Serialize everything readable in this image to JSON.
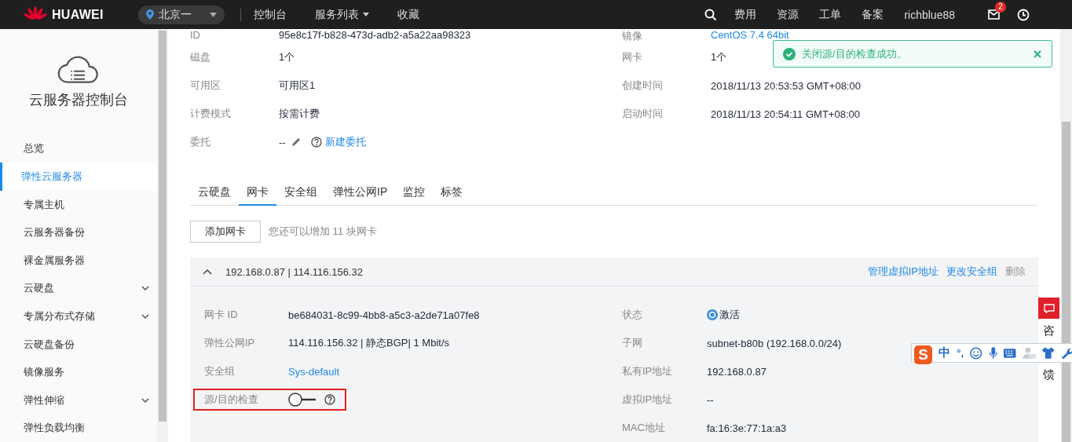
{
  "topbar": {
    "brand": "HUAWEI",
    "region": "北京一",
    "nav": [
      {
        "label": "控制台",
        "kind": "link"
      },
      {
        "label": "服务列表",
        "kind": "menu"
      },
      {
        "label": "收藏",
        "kind": "link"
      }
    ],
    "right_links": [
      "费用",
      "资源",
      "工单",
      "备案"
    ],
    "user": "richblue88",
    "mail_badge": "2"
  },
  "sidebar": {
    "title": "云服务器控制台",
    "items": [
      {
        "label": "总览",
        "kind": "link",
        "selected": false
      },
      {
        "label": "弹性云服务器",
        "kind": "link",
        "selected": true
      },
      {
        "label": "专属主机",
        "kind": "link",
        "selected": false
      },
      {
        "label": "云服务器备份",
        "kind": "link",
        "selected": false
      },
      {
        "label": "裸金属服务器",
        "kind": "link",
        "selected": false
      },
      {
        "label": "云硬盘",
        "kind": "group",
        "selected": false
      },
      {
        "label": "专属分布式存储",
        "kind": "group",
        "selected": false
      },
      {
        "label": "云硬盘备份",
        "kind": "link",
        "selected": false
      },
      {
        "label": "镜像服务",
        "kind": "link",
        "selected": false
      },
      {
        "label": "弹性伸缩",
        "kind": "group",
        "selected": false
      },
      {
        "label": "弹性负载均衡",
        "kind": "link",
        "selected": false
      }
    ]
  },
  "info": {
    "left": [
      {
        "label": "ID",
        "value": "95e8c17f-b828-473d-adb2-a5a22aa98323",
        "kind": "text"
      },
      {
        "label": "磁盘",
        "value": "1个",
        "kind": "text"
      },
      {
        "label": "可用区",
        "value": "可用区1",
        "kind": "text"
      },
      {
        "label": "计费模式",
        "value": "按需计费",
        "kind": "text"
      },
      {
        "label": "委托",
        "value": "--",
        "kind": "agency",
        "link": "新建委托"
      }
    ],
    "right": [
      {
        "label": "镜像",
        "value": "CentOS 7.4 64bit",
        "kind": "link"
      },
      {
        "label": "网卡",
        "value": "1个",
        "kind": "text"
      },
      {
        "label": "创建时间",
        "value": "2018/11/13 20:53:53 GMT+08:00",
        "kind": "text"
      },
      {
        "label": "启动时间",
        "value": "2018/11/13 20:54:11 GMT+08:00",
        "kind": "text"
      }
    ]
  },
  "tabs": [
    {
      "label": "云硬盘",
      "selected": false
    },
    {
      "label": "网卡",
      "selected": true
    },
    {
      "label": "安全组",
      "selected": false
    },
    {
      "label": "弹性公网IP",
      "selected": false
    },
    {
      "label": "监控",
      "selected": false
    },
    {
      "label": "标签",
      "selected": false
    }
  ],
  "add_button": "添加网卡",
  "add_hint": "您还可以增加 11 块网卡",
  "nic": {
    "title": "192.168.0.87 | 114.116.156.32",
    "expanded": true,
    "actions": [
      {
        "label": "管理虚拟IP地址",
        "disabled": false
      },
      {
        "label": "更改安全组",
        "disabled": false
      },
      {
        "label": "删除",
        "disabled": true
      }
    ],
    "left": [
      {
        "label": "网卡 ID",
        "value": "be684031-8c99-4bb8-a5c3-a2de71a07fe8",
        "kind": "text",
        "highlighted": false
      },
      {
        "label": "弹性公网IP",
        "value": "114.116.156.32 | 静态BGP| 1 Mbit/s",
        "kind": "text",
        "highlighted": false
      },
      {
        "label": "安全组",
        "value": "Sys-default",
        "kind": "link",
        "highlighted": false
      },
      {
        "label": "源/目的检查",
        "kind": "switch",
        "on": false,
        "highlighted": true
      }
    ],
    "right": [
      {
        "label": "状态",
        "value": "激活",
        "kind": "status"
      },
      {
        "label": "子网",
        "value": "subnet-b80b (192.168.0.0/24)",
        "kind": "text"
      },
      {
        "label": "私有IP地址",
        "value": "192.168.0.87",
        "kind": "text"
      },
      {
        "label": "虚拟IP地址",
        "value": "--",
        "kind": "text"
      },
      {
        "label": "MAC地址",
        "value": "fa:16:3e:77:1a:a3",
        "kind": "text"
      }
    ]
  },
  "toast": {
    "message": "关闭源/目的检查成功。"
  },
  "feedback": {
    "label_top": "咨",
    "label_bottom": "馈"
  },
  "ime": {
    "logo": "S",
    "mode": "中",
    "punct": "°,"
  }
}
